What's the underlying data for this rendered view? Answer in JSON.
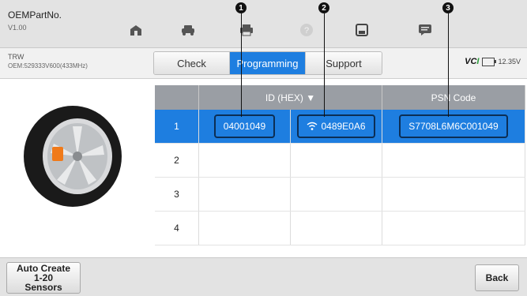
{
  "app": {
    "title": "OEMPartNo.",
    "version": "V1.00"
  },
  "toolbar": {
    "icons": [
      "home-icon",
      "vehicle-swap-icon",
      "print-icon",
      "help-icon",
      "save-icon",
      "message-icon"
    ]
  },
  "vehicle": {
    "make": "TRW",
    "oem": "OEM:529333V600(433MHz)"
  },
  "tabs": [
    {
      "label": "Check",
      "active": false
    },
    {
      "label": "Programming",
      "active": true
    },
    {
      "label": "Support",
      "active": false
    }
  ],
  "status": {
    "vci_logo": "VCI",
    "voltage": "12.35V"
  },
  "table": {
    "headers": {
      "index": "",
      "id": "ID (HEX) ▼",
      "psn": "PSN Code"
    },
    "rows": [
      {
        "index": "1",
        "id": "04001049",
        "freq": "0489E0A6",
        "psn": "S7708L6M6C001049",
        "selected": true
      },
      {
        "index": "2",
        "id": "",
        "freq": "",
        "psn": "",
        "selected": false
      },
      {
        "index": "3",
        "id": "",
        "freq": "",
        "psn": "",
        "selected": false
      },
      {
        "index": "4",
        "id": "",
        "freq": "",
        "psn": "",
        "selected": false
      }
    ]
  },
  "callouts": [
    "1",
    "2",
    "3"
  ],
  "bottom": {
    "auto_create": "Auto Create\n1-20\nSensors",
    "auto_line1": "Auto Create",
    "auto_line2": "1-20",
    "auto_line3": "Sensors",
    "back": "Back"
  },
  "colors": {
    "accent": "#1e7ee0",
    "header_gray": "#9a9ea4",
    "callout_border": "#0c2e55"
  }
}
